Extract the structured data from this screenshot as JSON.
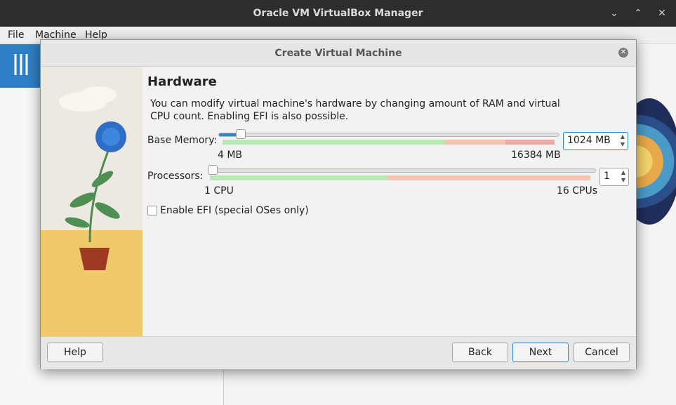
{
  "window": {
    "title": "Oracle VM VirtualBox Manager",
    "controls": [
      "chevron-down",
      "chevron-up",
      "close"
    ]
  },
  "menubar": {
    "items": [
      "File",
      "Machine",
      "Help"
    ]
  },
  "dialog": {
    "title": "Create Virtual Machine",
    "heading": "Hardware",
    "description": "You can modify virtual machine's hardware by changing amount of RAM and virtual CPU count. Enabling EFI is also possible.",
    "memory": {
      "label": "Base Memory:",
      "value": "1024",
      "unit": "MB",
      "min_label": "4 MB",
      "max_label": "16384 MB",
      "level": 0.0623
    },
    "processors": {
      "label": "Processors:",
      "value": "1",
      "min_label": "1 CPU",
      "max_label": "16 CPUs",
      "level": 0.0
    },
    "efi": {
      "label": "Enable EFI (special OSes only)",
      "checked": false
    },
    "buttons": {
      "help": "Help",
      "back": "Back",
      "next": "Next",
      "cancel": "Cancel"
    }
  },
  "colors": {
    "accent": "#2e86d1",
    "zone_ok": "#b9eab3",
    "zone_warn": "#f6c3b1",
    "zone_bad": "#f3a6a6"
  }
}
